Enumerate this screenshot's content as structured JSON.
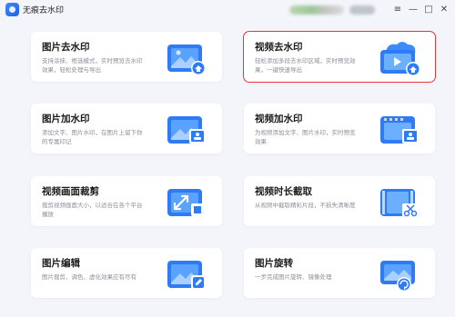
{
  "app": {
    "title": "无痕去水印"
  },
  "window_controls": {
    "menu": "≡",
    "minimize": "—",
    "maximize": "□",
    "close": "✕"
  },
  "cards": [
    {
      "title": "图片去水印",
      "desc": "支持涂抹、框选模式，实时预览去水印效果，轻松处理与导出",
      "icon": "image-remove-watermark-icon",
      "selected": false
    },
    {
      "title": "视频去水印",
      "desc": "轻松添加多段去水印区域，实时预览效果，一键快速导出",
      "icon": "video-remove-watermark-icon",
      "selected": true
    },
    {
      "title": "图片加水印",
      "desc": "添加文字、图片水印，在图片上留下你的专属印记",
      "icon": "image-add-watermark-icon",
      "selected": false
    },
    {
      "title": "视频加水印",
      "desc": "为视频添加文字、图片水印，实时预览效果",
      "icon": "video-add-watermark-icon",
      "selected": false
    },
    {
      "title": "视频画面裁剪",
      "desc": "裁剪视频画面大小，以适合在各个平台播放",
      "icon": "video-crop-icon",
      "selected": false
    },
    {
      "title": "视频时长截取",
      "desc": "从视频中截取精彩片段，不损失清晰度",
      "icon": "video-trim-icon",
      "selected": false
    },
    {
      "title": "图片编辑",
      "desc": "图片裁剪、调色、虚化效果应有尽有",
      "icon": "image-edit-icon",
      "selected": false
    },
    {
      "title": "图片旋转",
      "desc": "一步完成图片旋转、镜像处理",
      "icon": "image-rotate-icon",
      "selected": false
    }
  ]
}
